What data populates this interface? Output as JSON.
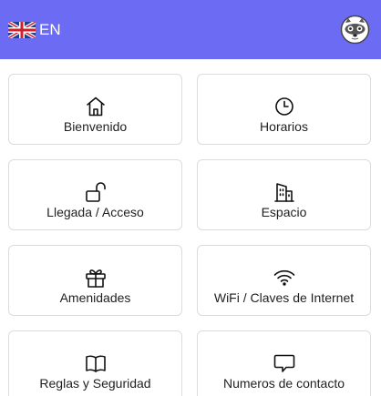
{
  "header": {
    "language_code": "EN",
    "flag_icon": "uk-flag-icon",
    "logo_icon": "raccoon-logo-icon",
    "accent_color": "#6b6cf3"
  },
  "menu": {
    "items": [
      {
        "label": "Bienvenido",
        "icon": "home-icon"
      },
      {
        "label": "Horarios",
        "icon": "clock-icon"
      },
      {
        "label": "Llegada / Acceso",
        "icon": "unlock-icon"
      },
      {
        "label": "Espacio",
        "icon": "building-icon"
      },
      {
        "label": "Amenidades",
        "icon": "gift-icon"
      },
      {
        "label": "WiFi / Claves de Internet",
        "icon": "wifi-icon"
      },
      {
        "label": "Reglas y Seguridad",
        "icon": "book-icon"
      },
      {
        "label": "Numeros de contacto",
        "icon": "chat-bubble-icon"
      }
    ]
  }
}
